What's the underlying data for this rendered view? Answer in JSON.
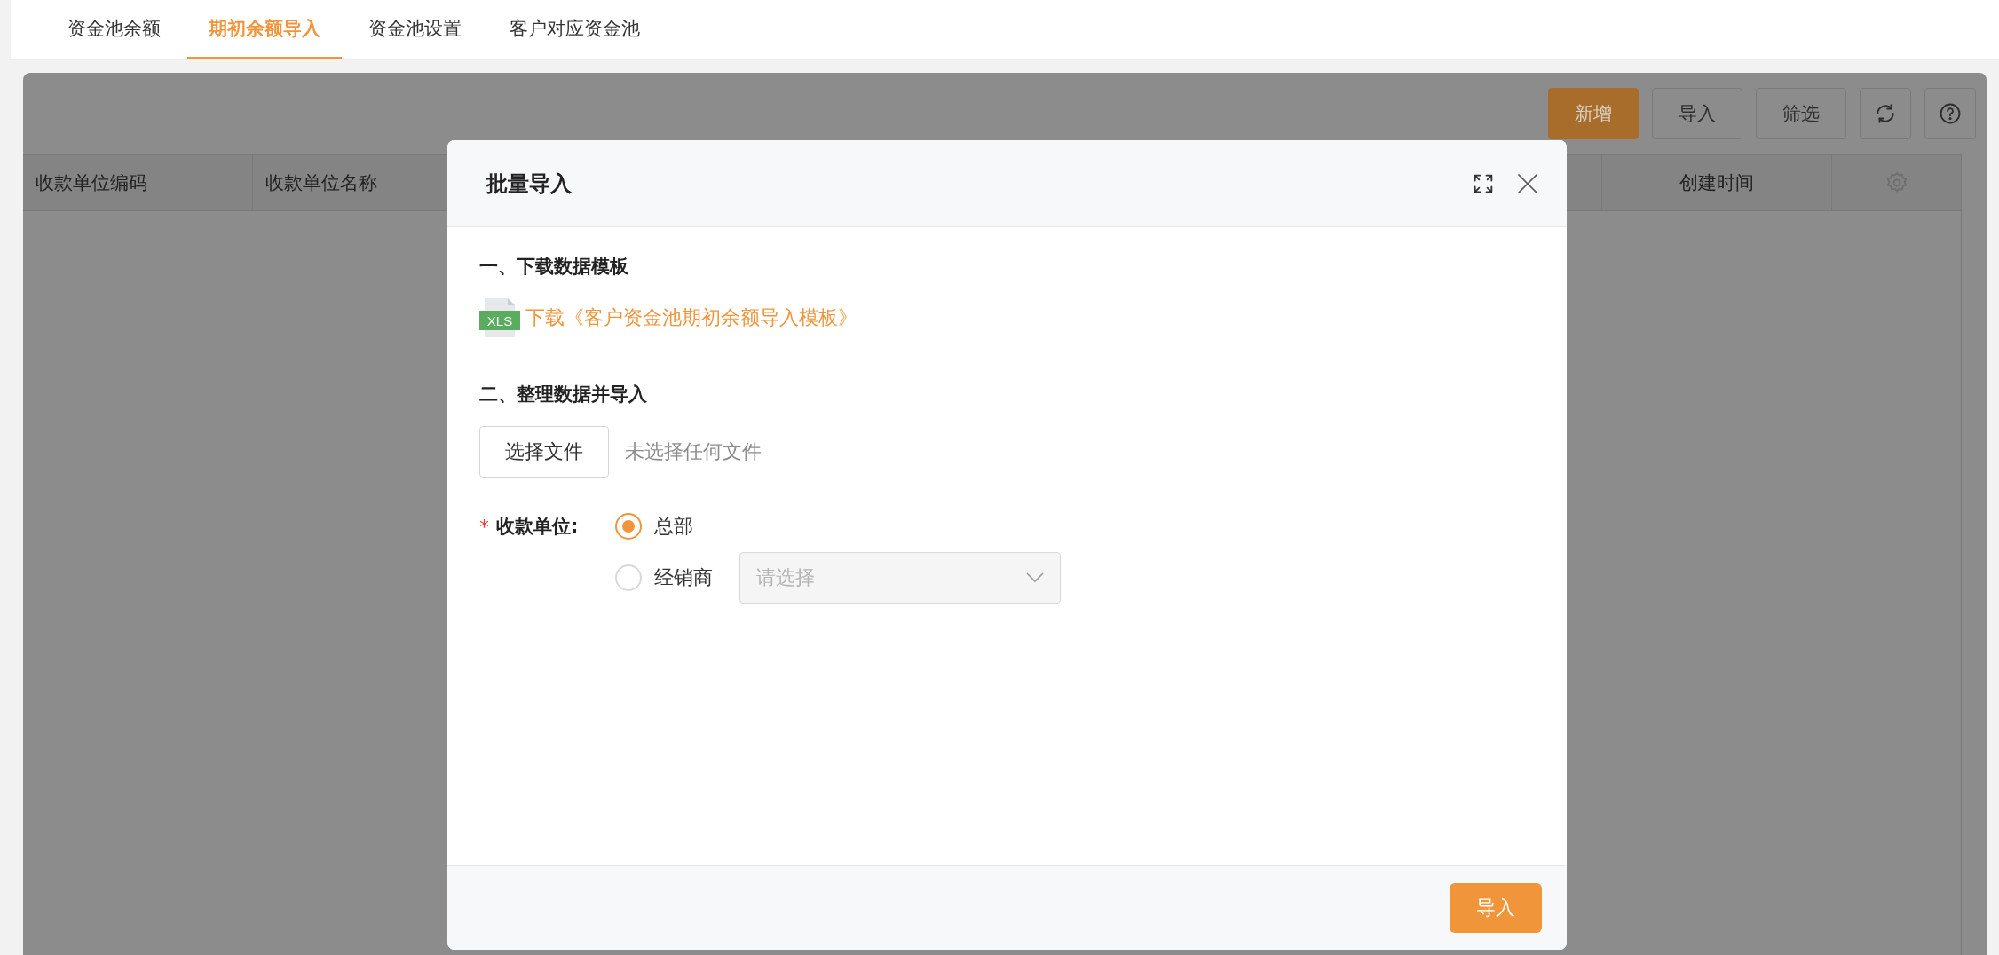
{
  "tabs": [
    {
      "label": "资金池余额",
      "selected": false
    },
    {
      "label": "期初余额导入",
      "selected": true
    },
    {
      "label": "资金池设置",
      "selected": false
    },
    {
      "label": "客户对应资金池",
      "selected": false
    }
  ],
  "toolbar": [
    {
      "kind": "primary",
      "label": "新增"
    },
    {
      "kind": "default",
      "label": "导入"
    },
    {
      "kind": "default",
      "label": "筛选"
    },
    {
      "kind": "refresh"
    },
    {
      "kind": "help"
    }
  ],
  "table": {
    "columns": [
      {
        "kind": "label",
        "label": "收款单位编码"
      },
      {
        "kind": "label",
        "label": "收款单位名称"
      },
      {
        "kind": "hidden"
      },
      {
        "kind": "centered_label",
        "label": "创建时间"
      },
      {
        "kind": "settings"
      }
    ]
  },
  "dialog": {
    "title": "批量导入",
    "step1": {
      "heading": "一、下载数据模板",
      "file_type": "XLS",
      "link": "下载《客户资金池期初余额导入模板》"
    },
    "step2": {
      "heading": "二、整理数据并导入",
      "file_button": "选择文件",
      "file_status": "未选择任何文件"
    },
    "field": {
      "required_mark": "*",
      "label": "收款单位:",
      "options": [
        {
          "label": "总部",
          "selected": true
        },
        {
          "label": "经销商",
          "selected": false
        }
      ],
      "select": {
        "placeholder": "请选择",
        "disabled": true
      }
    },
    "submit": "导入"
  }
}
